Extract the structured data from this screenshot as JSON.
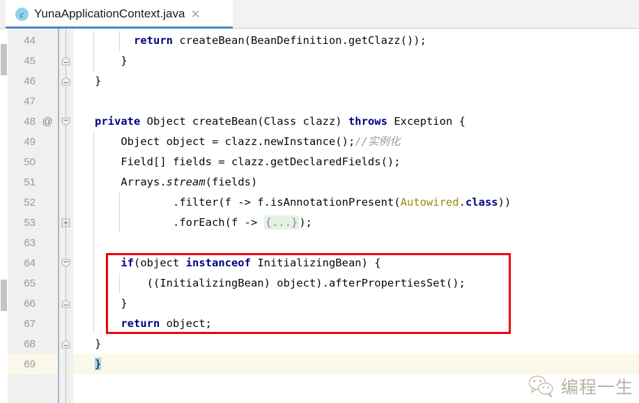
{
  "window": {
    "tab": {
      "icon": "java-class-icon",
      "title": "YunaApplicationContext.java",
      "close_label": "✕"
    }
  },
  "editor": {
    "annotation_marker": "@",
    "language": "java",
    "current_line": 69,
    "lines": [
      {
        "num": "44",
        "fold": "none",
        "indent_guides": [
          0,
          1
        ],
        "tokens": [
          {
            "t": "      ",
            "c": "plain"
          },
          {
            "t": "return",
            "c": "kw"
          },
          {
            "t": " createBean(BeanDefinition.getClazz());",
            "c": "plain"
          }
        ]
      },
      {
        "num": "45",
        "fold": "collapse-up",
        "indent_guides": [
          0
        ],
        "tokens": [
          {
            "t": "    }",
            "c": "plain"
          }
        ]
      },
      {
        "num": "46",
        "fold": "collapse-up",
        "indent_guides": [],
        "tokens": [
          {
            "t": "}",
            "c": "plain"
          }
        ]
      },
      {
        "num": "47",
        "fold": "none",
        "indent_guides": [],
        "tokens": []
      },
      {
        "num": "48",
        "fold": "expand-down",
        "annotation": "@",
        "indent_guides": [],
        "tokens": [
          {
            "t": "private",
            "c": "kw"
          },
          {
            "t": " Object createBean(Class clazz) ",
            "c": "plain"
          },
          {
            "t": "throws",
            "c": "kw"
          },
          {
            "t": " Exception {",
            "c": "plain"
          }
        ]
      },
      {
        "num": "49",
        "fold": "none",
        "indent_guides": [
          0
        ],
        "tokens": [
          {
            "t": "    Object object = clazz.newInstance();",
            "c": "plain"
          },
          {
            "t": "//实例化",
            "c": "comment"
          }
        ]
      },
      {
        "num": "50",
        "fold": "none",
        "indent_guides": [
          0
        ],
        "tokens": [
          {
            "t": "    Field[] fields = clazz.getDeclaredFields();",
            "c": "plain"
          }
        ]
      },
      {
        "num": "51",
        "fold": "none",
        "indent_guides": [
          0
        ],
        "tokens": [
          {
            "t": "    Arrays.",
            "c": "plain"
          },
          {
            "t": "stream",
            "c": "ital"
          },
          {
            "t": "(fields)",
            "c": "plain"
          }
        ]
      },
      {
        "num": "52",
        "fold": "none",
        "indent_guides": [
          0,
          1
        ],
        "tokens": [
          {
            "t": "            .filter(f -> f.isAnnotationPresent(",
            "c": "plain"
          },
          {
            "t": "Autowired",
            "c": "anno"
          },
          {
            "t": ".",
            "c": "plain"
          },
          {
            "t": "class",
            "c": "kw"
          },
          {
            "t": "))",
            "c": "plain"
          }
        ]
      },
      {
        "num": "53",
        "fold": "collapsed-plus",
        "indent_guides": [
          0,
          1
        ],
        "tokens": [
          {
            "t": "            .forEach(f -> ",
            "c": "plain"
          },
          {
            "t": "{...}",
            "c": "fold-ph"
          },
          {
            "t": ");",
            "c": "plain"
          }
        ]
      },
      {
        "num": "63",
        "fold": "none",
        "indent_guides": [
          0
        ],
        "tokens": []
      },
      {
        "num": "64",
        "fold": "expand-down",
        "indent_guides": [
          0
        ],
        "tokens": [
          {
            "t": "    ",
            "c": "plain"
          },
          {
            "t": "if",
            "c": "kw"
          },
          {
            "t": "(object ",
            "c": "plain"
          },
          {
            "t": "instanceof",
            "c": "kw"
          },
          {
            "t": " InitializingBean) {",
            "c": "plain"
          }
        ]
      },
      {
        "num": "65",
        "fold": "none",
        "indent_guides": [
          0,
          1
        ],
        "tokens": [
          {
            "t": "        ((InitializingBean) object).afterPropertiesSet();",
            "c": "plain"
          }
        ]
      },
      {
        "num": "66",
        "fold": "collapse-up",
        "indent_guides": [
          0
        ],
        "tokens": [
          {
            "t": "    }",
            "c": "plain"
          }
        ]
      },
      {
        "num": "67",
        "fold": "none",
        "indent_guides": [
          0
        ],
        "tokens": [
          {
            "t": "    ",
            "c": "plain"
          },
          {
            "t": "return",
            "c": "kw"
          },
          {
            "t": " object;",
            "c": "plain"
          }
        ]
      },
      {
        "num": "68",
        "fold": "collapse-up",
        "indent_guides": [],
        "tokens": [
          {
            "t": "}",
            "c": "plain"
          }
        ]
      },
      {
        "num": "69",
        "fold": "none",
        "current": true,
        "indent_guides": [],
        "tokens": [
          {
            "t": "}",
            "c": "sel-brace"
          }
        ]
      }
    ]
  },
  "annotation_box": {
    "label": "red-highlight-rectangle",
    "color": "#f00000",
    "covers_lines": [
      "64",
      "65",
      "66"
    ]
  },
  "watermark": {
    "text": "编程一生",
    "logo": "wechat-logo",
    "color": "#8e8468"
  },
  "colors": {
    "keyword": "#000080",
    "annotation": "#9e880d",
    "comment": "#9b9b9b",
    "gutter_bg": "#f0f0f0",
    "current_line_bg": "#fcf8e9",
    "selection_bg": "#a6d2f4",
    "fold_placeholder_bg": "#e4f2e4",
    "tab_underline": "#4a86c8"
  }
}
